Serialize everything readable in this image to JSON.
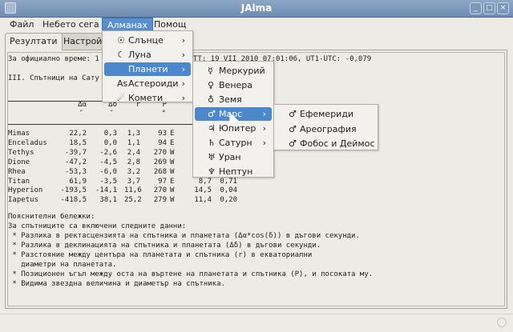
{
  "window": {
    "title": "JAlma",
    "buttons": [
      "_",
      "□",
      "×"
    ]
  },
  "menubar": [
    "Файл",
    "Небето сега",
    "Алманах",
    "Помощ"
  ],
  "tabs": [
    "Резултати",
    "Настройки"
  ],
  "content": {
    "line1_left": "За официално време: 1",
    "line1_right": "TT: 19 VII 2010 07:01:06, UT1-UTC: -0,079",
    "heading": "III. Спътници на Сату",
    "headers": {
      "da": "Δα",
      "dd": "Δδ",
      "r": "r",
      "p": "P",
      "da_unit": "″",
      "dd_unit": "″",
      "p_unit": "°"
    },
    "rows": [
      {
        "name": "Mimas",
        "da": "22,2",
        "dd": "0,3",
        "r": "1,3",
        "p": "93",
        "dir": "E"
      },
      {
        "name": "Enceladus",
        "da": "18,5",
        "dd": "0,0",
        "r": "1,1",
        "p": "94",
        "dir": "E"
      },
      {
        "name": "Tethys",
        "da": "-39,7",
        "dd": "-2,6",
        "r": "2,4",
        "p": "270",
        "dir": "W"
      },
      {
        "name": "Dione",
        "da": "-47,2",
        "dd": "-4,5",
        "r": "2,8",
        "p": "269",
        "dir": "W"
      },
      {
        "name": "Rhea",
        "da": "-53,3",
        "dd": "-6,0",
        "r": "3,2",
        "p": "268",
        "dir": "W"
      },
      {
        "name": "Titan",
        "da": "61,9",
        "dd": "-3,5",
        "r": "3,7",
        "p": "97",
        "dir": "E",
        "mag": "8,7",
        "diam": "0,71"
      },
      {
        "name": "Hyperion",
        "da": "-193,5",
        "dd": "-14,1",
        "r": "11,6",
        "p": "270",
        "dir": "W",
        "mag": "14,5",
        "diam": "0,04"
      },
      {
        "name": "Iapetus",
        "da": "-418,5",
        "dd": "38,1",
        "r": "25,2",
        "p": "279",
        "dir": "W",
        "mag": "11,4",
        "diam": "0,20"
      }
    ],
    "notes": [
      "Пояснителни бележки:",
      "За спътниците са включени следните данни:",
      " * Разлика в ректасцензията на спътника и планетата (Δα*cos(δ)) в дъгови секунди.",
      " * Разлика в деклинацията на спътника и планетата (Δδ) в дъгови секунди.",
      " * Разстояние между центъра на планетата и спътника (r) в екваториални",
      "   диаметри на планетата.",
      " * Позиционен ъгъл между оста на въртене на планетата и спътника (P), и посоката му.",
      " * Видима звездна величина и диаметър на спътника."
    ]
  },
  "almanac_menu": [
    {
      "icon": "☉",
      "label": "Слънце"
    },
    {
      "icon": "☾",
      "label": "Луна"
    },
    {
      "icon": "",
      "label": "Планети"
    },
    {
      "icon": "As",
      "label": "Астероиди"
    },
    {
      "icon": "☄",
      "label": "Комети"
    }
  ],
  "planets_menu": [
    {
      "icon": "☿",
      "label": "Меркурий"
    },
    {
      "icon": "♀",
      "label": "Венера"
    },
    {
      "icon": "♁",
      "label": "Земя"
    },
    {
      "icon": "♂",
      "label": "Марс"
    },
    {
      "icon": "♃",
      "label": "Юпитер"
    },
    {
      "icon": "♄",
      "label": "Сатурн"
    },
    {
      "icon": "♅",
      "label": "Уран"
    },
    {
      "icon": "♆",
      "label": "Нептун"
    }
  ],
  "mars_menu": [
    {
      "icon": "♂",
      "label": "Ефемериди"
    },
    {
      "icon": "♂",
      "label": "Ареография"
    },
    {
      "icon": "♂",
      "label": "Фобос и Деймос"
    }
  ],
  "submenu_arrow": "›"
}
